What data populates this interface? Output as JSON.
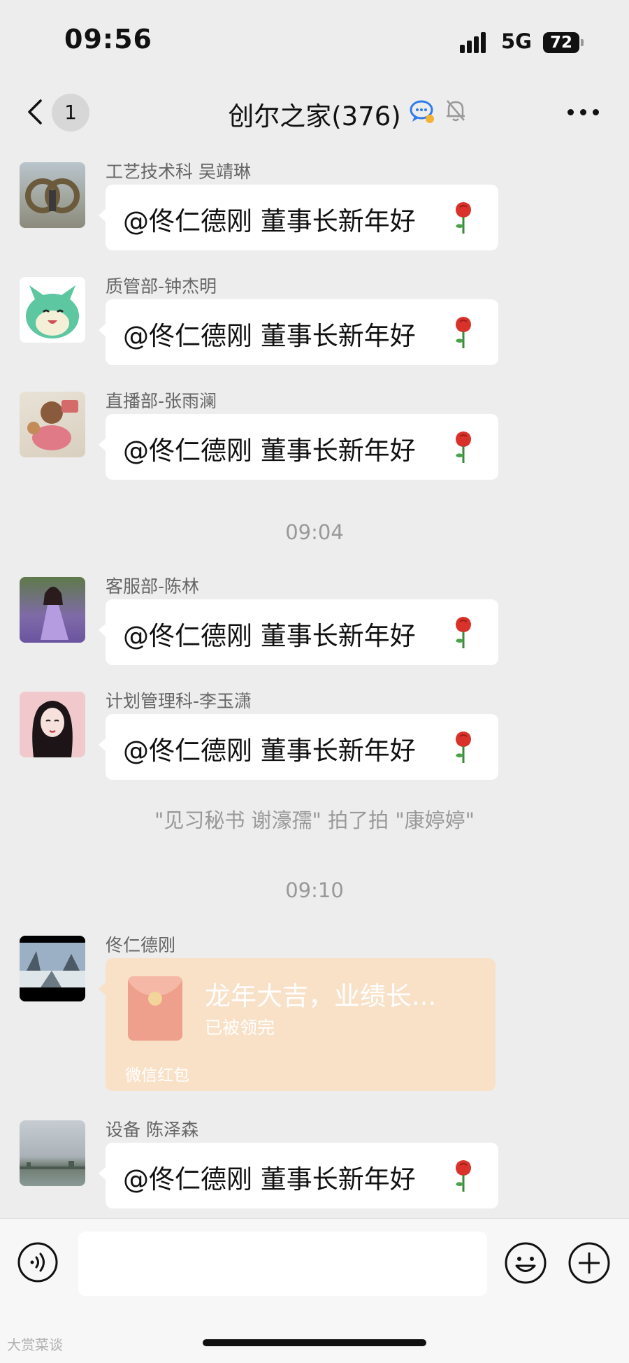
{
  "status_bar": {
    "time": "09:56",
    "network": "5G",
    "battery": "72"
  },
  "nav": {
    "unread_count": "1",
    "title": "创尔之家(376)"
  },
  "messages": [
    {
      "sender": "工艺技术科 吴靖琳",
      "text": "@佟仁德刚  董事长新年好"
    },
    {
      "sender": "质管部-钟杰明",
      "text": "@佟仁德刚  董事长新年好"
    },
    {
      "sender": "直播部-张雨澜",
      "text": "@佟仁德刚  董事长新年好"
    },
    {
      "sender": "客服部-陈林",
      "text": "@佟仁德刚  董事长新年好"
    },
    {
      "sender": "计划管理科-李玉潇",
      "text": "@佟仁德刚  董事长新年好"
    },
    {
      "sender": "佟仁德刚"
    },
    {
      "sender": "设备 陈泽森",
      "text": "@佟仁德刚  董事长新年好"
    }
  ],
  "timestamps": [
    "09:04",
    "09:10"
  ],
  "system_message": "\"见习秘书 谢濠孺\" 拍了拍 \"康婷婷\"",
  "red_packet": {
    "title": "龙年大吉，业绩长...",
    "status": "已被领完",
    "label": "微信红包"
  },
  "input": {
    "value": ""
  },
  "watermark": "大赏菜谈"
}
